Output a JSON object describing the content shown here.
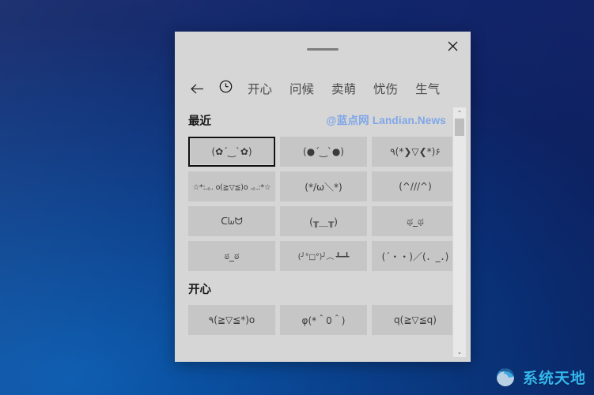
{
  "desktop": {
    "background_top": "#0a3f8c",
    "background_bottom": "#0b5bb0"
  },
  "panel": {
    "titlebar": {
      "drag_handle_name": "drag-handle",
      "close_label": "✕"
    },
    "tabs": {
      "back_label": "←",
      "items": [
        {
          "label": "",
          "icon": "clock-icon",
          "selected": true
        },
        {
          "label": "开心",
          "icon": "",
          "selected": false
        },
        {
          "label": "问候",
          "icon": "",
          "selected": false
        },
        {
          "label": "卖萌",
          "icon": "",
          "selected": false
        },
        {
          "label": "忧伤",
          "icon": "",
          "selected": false
        },
        {
          "label": "生气",
          "icon": "",
          "selected": false
        }
      ]
    },
    "sections": [
      {
        "title": "最近",
        "watermark": "@蓝点网 Landian.News",
        "items": [
          {
            "text": "(✿´‿`✿)",
            "focused": true,
            "tiny": false
          },
          {
            "text": "(●´‿`●)",
            "focused": false,
            "tiny": false
          },
          {
            "text": "٩(*❯▽❮*)۶",
            "focused": false,
            "tiny": false
          },
          {
            "text": "☆*:.｡. o(≧▽≦)o .｡.:*☆",
            "focused": false,
            "tiny": true
          },
          {
            "text": "(*/ω＼*)",
            "focused": false,
            "tiny": false
          },
          {
            "text": "(^///^)",
            "focused": false,
            "tiny": false
          },
          {
            "text": "ᑕᘈᗢ",
            "focused": false,
            "tiny": false
          },
          {
            "text": "(╥＿╥)",
            "focused": false,
            "tiny": false
          },
          {
            "text": "ಥ_ಥ",
            "focused": false,
            "tiny": false
          },
          {
            "text": "ಠ_ಠ",
            "focused": false,
            "tiny": false
          },
          {
            "text": "(╯°□°)╯︵ ┻━┻",
            "focused": false,
            "tiny": false
          },
          {
            "text": "(´・・)／(．_．)",
            "focused": false,
            "tiny": false
          }
        ]
      },
      {
        "title": "开心",
        "watermark": "",
        "items": [
          {
            "text": "٩(≧▽≦*)o",
            "focused": false,
            "tiny": false
          },
          {
            "text": "φ(*＾0＾)",
            "focused": false,
            "tiny": false
          },
          {
            "text": "q(≧▽≦q)",
            "focused": false,
            "tiny": false
          }
        ]
      }
    ],
    "scrollbar": {
      "up_label": "⌃",
      "down_label": "⌄"
    }
  },
  "brand": {
    "text": "系统天地",
    "accent_color": "#35b7ef"
  }
}
